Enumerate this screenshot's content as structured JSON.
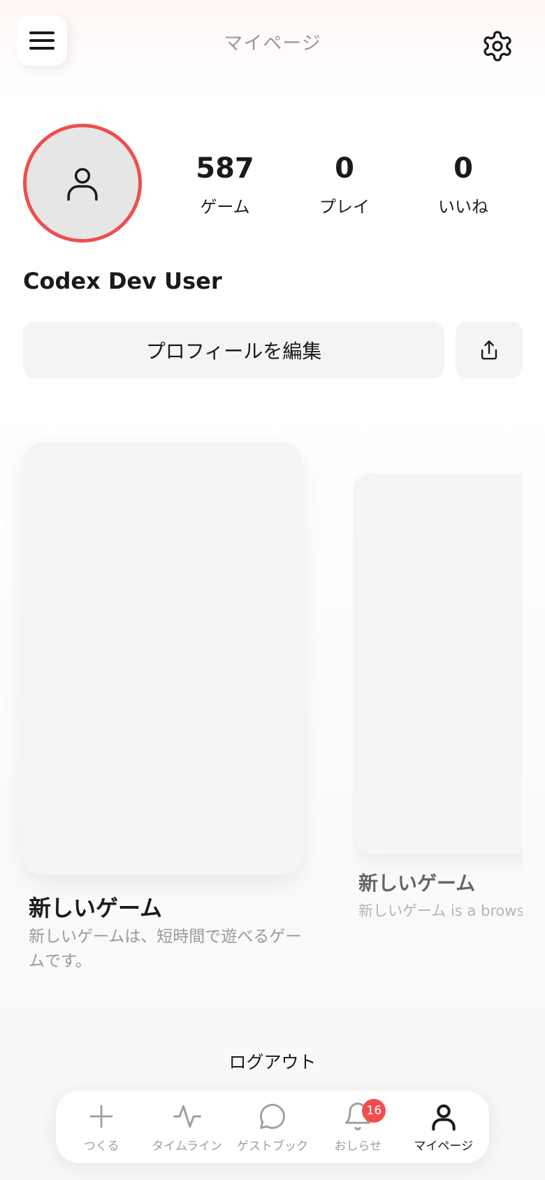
{
  "header": {
    "title": "マイページ",
    "menu_icon": "hamburger-icon",
    "settings_icon": "gear-icon"
  },
  "profile": {
    "avatar_icon": "user-icon",
    "avatar_ring_color": "#ef4e4e",
    "name": "Codex Dev User",
    "stats": [
      {
        "value": "587",
        "label": "ゲーム"
      },
      {
        "value": "0",
        "label": "プレイ"
      },
      {
        "value": "0",
        "label": "いいね"
      }
    ],
    "edit_label": "プロフィールを編集",
    "share_icon": "share-icon"
  },
  "games": [
    {
      "title": "新しいゲーム",
      "description": "新しいゲームは、短時間で遊べるゲームです。"
    },
    {
      "title": "新しいゲーム",
      "description": "新しいゲーム is a browse"
    }
  ],
  "logout_label": "ログアウト",
  "bottom_nav": {
    "items": [
      {
        "label": "つくる",
        "icon": "plus-icon"
      },
      {
        "label": "タイムライン",
        "icon": "activity-icon"
      },
      {
        "label": "ゲストブック",
        "icon": "chat-bubble-icon"
      },
      {
        "label": "おしらせ",
        "icon": "bell-icon",
        "badge": "16"
      },
      {
        "label": "マイページ",
        "icon": "user-icon",
        "active": true
      }
    ]
  },
  "colors": {
    "accent": "#ef4e4e",
    "text": "#1a1a1a",
    "muted": "#9a9a9a"
  }
}
